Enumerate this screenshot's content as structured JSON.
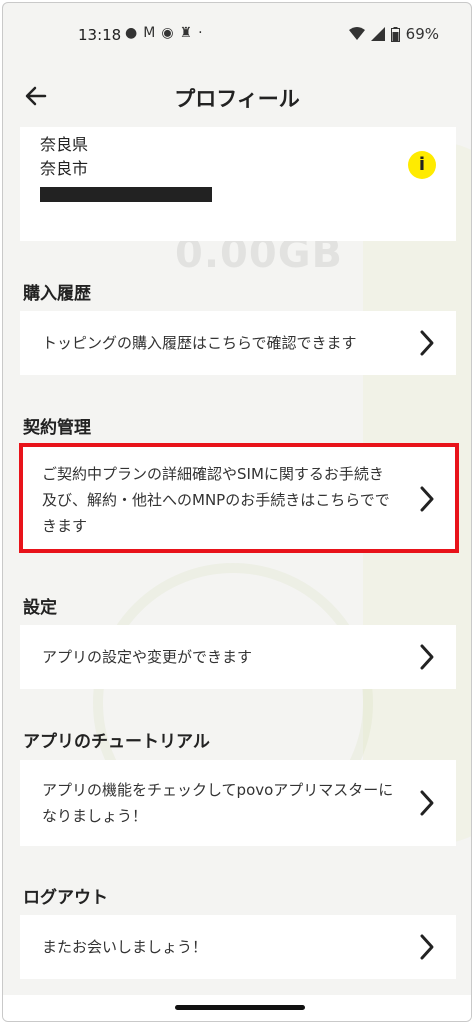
{
  "status_bar": {
    "time": "13:18",
    "notification_icons": [
      "chat-icon",
      "mcdonalds-icon",
      "messenger-icon",
      "figure-icon",
      "dot-icon"
    ],
    "battery": "69%"
  },
  "app_bar": {
    "title": "プロフィール"
  },
  "address": {
    "lines": [
      "奈良県",
      "奈良市"
    ],
    "redacted": true
  },
  "sections": [
    {
      "title": "購入履歴",
      "row_text": "トッピングの購入履歴はこちらで確認できます"
    },
    {
      "title": "契約管理",
      "row_text": "ご契約中プランの詳細確認やSIMに関するお手続き及び、解約・他社へのMNPのお手続きはこちらでできます"
    },
    {
      "title": "設定",
      "row_text": "アプリの設定や変更ができます"
    },
    {
      "title": "アプリのチュートリアル",
      "row_text": "アプリの機能をチェックしてpovoアプリマスターになりましょう！"
    },
    {
      "title": "ログアウト",
      "row_text": "またお会いしましょう！"
    }
  ],
  "colors": {
    "accent_yellow": "#ffeb00",
    "highlight_red": "#e8131a",
    "background": "#f4f4f2"
  }
}
